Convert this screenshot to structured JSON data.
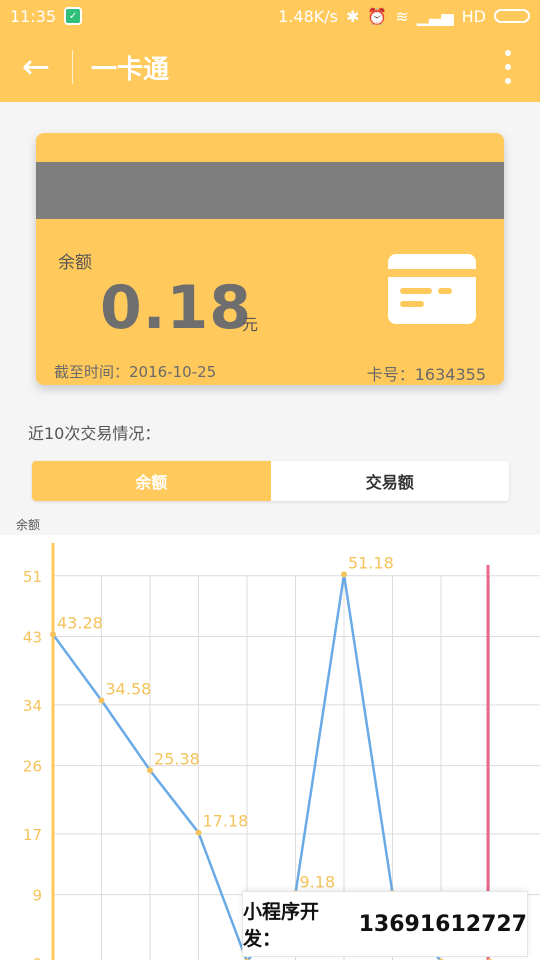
{
  "status_bar": {
    "time": "11:35",
    "speed": "1.48K/s",
    "network": "HD"
  },
  "app_bar": {
    "title": "一卡通"
  },
  "card": {
    "balance_label": "余额",
    "amount": "0.18",
    "unit": "元",
    "deadline_label": "截至时间：",
    "deadline_value": "2016-10-25",
    "card_no_label": "卡号：",
    "card_no_value": "1634355"
  },
  "recent_label": "近10次交易情况：",
  "tabs": [
    {
      "label": "余额",
      "active": true
    },
    {
      "label": "交易额",
      "active": false
    }
  ],
  "colors": {
    "accent": "#ffc95c",
    "line": "#6aaae6",
    "label": "#f5c35b",
    "marker_red": "#e86a8c",
    "card_text": "#6e6e6e"
  },
  "chart_data": {
    "type": "line",
    "ylabel": "余额",
    "y_ticks": [
      0,
      9,
      17,
      26,
      34,
      43,
      51
    ],
    "y_tick_labels": [
      "0",
      "9",
      "17",
      "26",
      "34",
      "43",
      "51"
    ],
    "ylim": [
      0,
      51.5
    ],
    "x_count": 10,
    "values": [
      43.28,
      34.58,
      25.38,
      17.18,
      0.18,
      9.18,
      51.18,
      9.18,
      0.18,
      0.18
    ],
    "labels": [
      "43.28",
      "34.58",
      "25.38",
      "17.18",
      "",
      "9.18",
      "51.18",
      "",
      "",
      ""
    ],
    "grid": true
  },
  "watermark": {
    "label": "小程序开发：",
    "phone": "13691612727"
  }
}
